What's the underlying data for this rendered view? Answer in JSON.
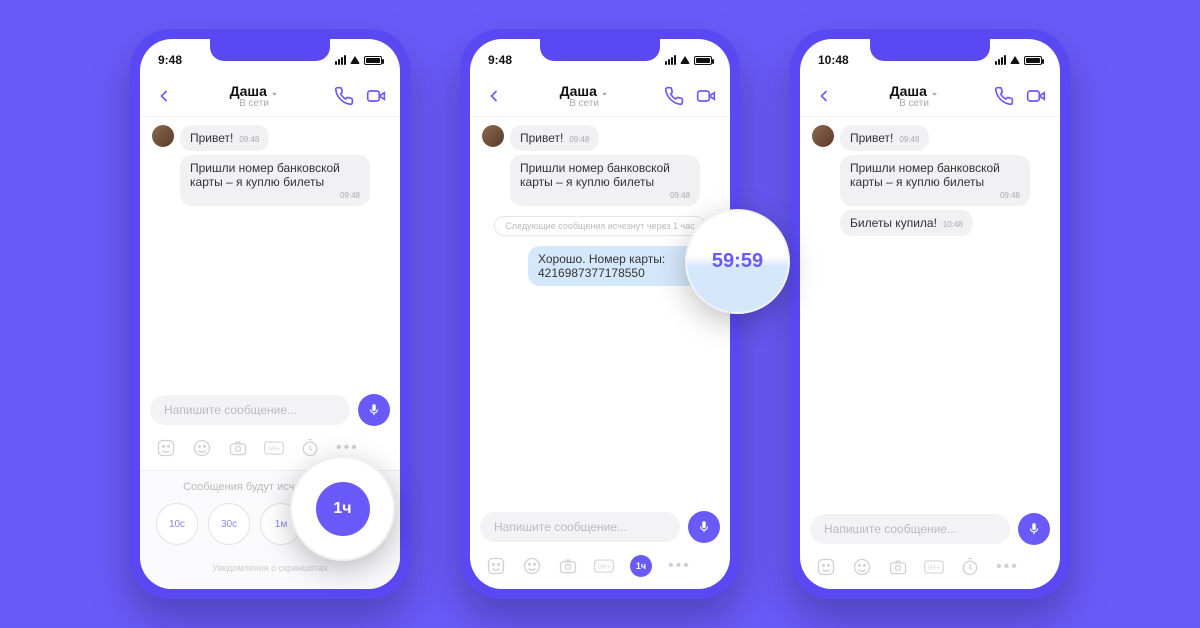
{
  "accent": "#6a5af9",
  "screens": [
    {
      "time": "9:48",
      "contact": "Даша",
      "status": "В сети",
      "msg1": "Привет!",
      "msg1_ts": "09:48",
      "msg2": "Пришли номер банковской карты – я куплю билеты",
      "msg2_ts": "09:48",
      "composer_ph": "Напишите сообщение...",
      "picker_label": "Сообщения будут исчезать через:",
      "opts": [
        "10с",
        "30с",
        "1м",
        "1ч"
      ],
      "selected_opt": "1ч",
      "picker_foot": "Уведомления о скриншотах",
      "mag_label": "1ч"
    },
    {
      "time": "9:48",
      "contact": "Даша",
      "status": "В сети",
      "msg1": "Привет!",
      "msg1_ts": "09:48",
      "msg2": "Пришли номер банковской карты – я куплю билеты",
      "msg2_ts": "09:48",
      "sys": "Следующие сообщения исчезнут через 1 час",
      "msg3": "Хорошо. Номер карты: 4216987377178550",
      "composer_ph": "Напишите сообщение...",
      "tb_badge": "1ч",
      "mag_timer": "59:59"
    },
    {
      "time": "10:48",
      "contact": "Даша",
      "status": "В сети",
      "msg1": "Привет!",
      "msg1_ts": "09:48",
      "msg2": "Пришли номер банковской карты – я куплю билеты",
      "msg2_ts": "09:48",
      "msg3": "Билеты купила!",
      "msg3_ts": "10:48",
      "composer_ph": "Напишите сообщение..."
    }
  ]
}
